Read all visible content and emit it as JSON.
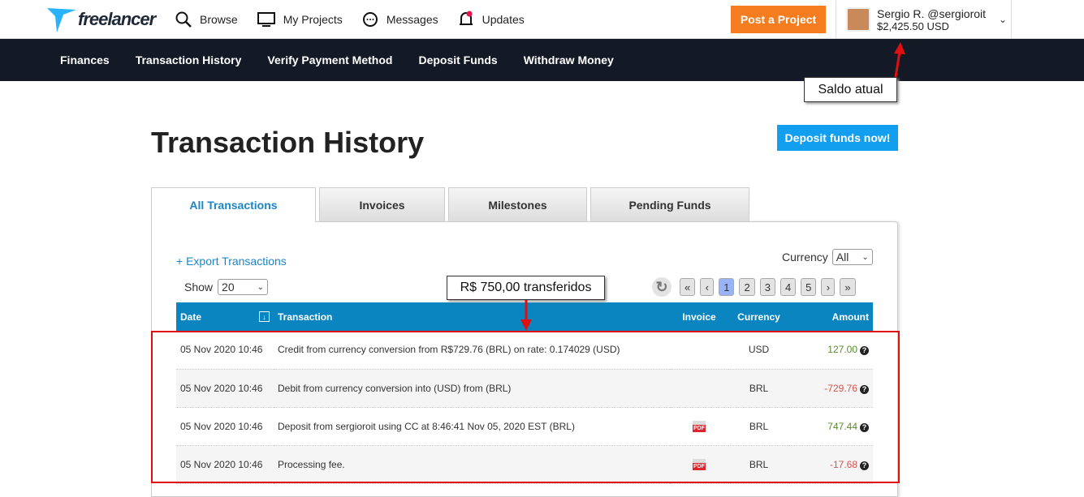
{
  "header": {
    "logo": "freelancer",
    "nav": [
      {
        "icon": "search-icon",
        "label": "Browse"
      },
      {
        "icon": "monitor-icon",
        "label": "My Projects"
      },
      {
        "icon": "chat-icon",
        "label": "Messages"
      },
      {
        "icon": "bell-icon",
        "label": "Updates"
      }
    ],
    "post_button": "Post a Project",
    "user": {
      "name": "Sergio R. @sergioroit",
      "balance": "$2,425.50 USD"
    }
  },
  "subnav": [
    "Finances",
    "Transaction History",
    "Verify Payment Method",
    "Deposit Funds",
    "Withdraw Money"
  ],
  "page": {
    "title": "Transaction History",
    "deposit_button": "Deposit funds now!"
  },
  "tabs": [
    "All Transactions",
    "Invoices",
    "Milestones",
    "Pending Funds"
  ],
  "controls": {
    "export": "+ Export Transactions",
    "currency_label": "Currency",
    "currency_value": "All",
    "show_label": "Show",
    "show_value": "20",
    "pages": [
      "«",
      "‹",
      "1",
      "2",
      "3",
      "4",
      "5",
      "›",
      "»"
    ]
  },
  "table": {
    "headers": [
      "Date",
      "Transaction",
      "Invoice",
      "Currency",
      "Amount"
    ],
    "rows": [
      {
        "date": "05 Nov 2020 10:46",
        "transaction": "Credit from currency conversion from R$729.76 (BRL) on rate: 0.174029 (USD)",
        "invoice": "",
        "currency": "USD",
        "amount": "127.00"
      },
      {
        "date": "05 Nov 2020 10:46",
        "transaction": "Debit from currency conversion into (USD) from (BRL)",
        "invoice": "",
        "currency": "BRL",
        "amount": "-729.76"
      },
      {
        "date": "05 Nov 2020 10:46",
        "transaction": "Deposit from sergioroit using CC at 8:46:41 Nov 05, 2020 EST (BRL)",
        "invoice": "PDF",
        "currency": "BRL",
        "amount": "747.44"
      },
      {
        "date": "05 Nov 2020 10:46",
        "transaction": "Processing fee.",
        "invoice": "PDF",
        "currency": "BRL",
        "amount": "-17.68"
      }
    ]
  },
  "annotations": {
    "balance": "Saldo atual",
    "transfer": "R$ 750,00 transferidos"
  }
}
